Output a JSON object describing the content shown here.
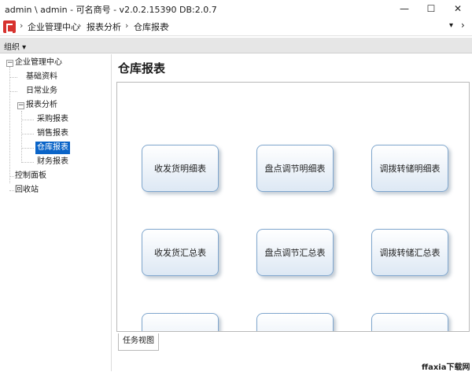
{
  "window": {
    "title": "admin \\ admin - 可名商号 - v2.0.2.15390  DB:2.0.7",
    "minimize_glyph": "—",
    "maximize_glyph": "☐",
    "close_glyph": "✕"
  },
  "address_bar": {
    "app_icon": "app-logo-icon",
    "crumbs": [
      "企业管理中心",
      "报表分析",
      "仓库报表"
    ],
    "separator": "›",
    "dropdown_glyph": "▾",
    "forward_glyph": "›"
  },
  "toolbar": {
    "org_label": "组织 ▾"
  },
  "tree": {
    "root": "企业管理中心",
    "items": [
      "基础资料",
      "日常业务",
      "报表分析"
    ],
    "report_children": [
      "采购报表",
      "销售报表",
      "仓库报表",
      "财务报表"
    ],
    "other_roots": [
      "控制面板",
      "回收站"
    ],
    "selected": "仓库报表",
    "expanded_glyph": "−"
  },
  "main": {
    "title": "仓库报表",
    "cards": [
      "收发货明细表",
      "盘点调节明细表",
      "调拨转储明细表",
      "收发货汇总表",
      "盘点调节汇总表",
      "调拨转储汇总表"
    ]
  },
  "bottom": {
    "tab_label": "任务视图"
  },
  "watermark": "ffaxia下载网",
  "colors": {
    "selection": "#0a64c8",
    "card_border": "#7fa6cd",
    "brand_red": "#d7322e"
  }
}
